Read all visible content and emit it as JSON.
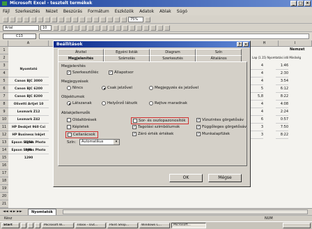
{
  "window": {
    "title": "Microsoft Excel - tesztelt termékek",
    "controls": [
      "_",
      "□",
      "×"
    ]
  },
  "menu": [
    "Fájl",
    "Szerkesztés",
    "Nézet",
    "Beszúrás",
    "Formátum",
    "Eszközök",
    "Adatok",
    "Ablak",
    "Súgó"
  ],
  "toolbar": {
    "zoom": "75%",
    "font": "Arial",
    "font_size": "10"
  },
  "formula_bar": {
    "cell_ref": "C13"
  },
  "sheet": {
    "col_headers": [
      "A",
      "B",
      "C",
      "D",
      "E",
      "F",
      "G",
      "H",
      "I"
    ],
    "row_numbers": [
      "1",
      "2",
      "3",
      "4",
      "5",
      "6",
      "7",
      "8",
      "9",
      "10",
      "11",
      "12",
      "13",
      "14",
      "15",
      "16",
      "17",
      "18",
      "19",
      "20",
      "21"
    ],
    "header_label": "Nyomtató",
    "right_header": "Nemzet",
    "right_subheader": "Lap (1.15) Nyomtatási idő Minőség",
    "rows": [
      {
        "name": "Canon BJC 3000",
        "c1": "4",
        "c2": "1:46"
      },
      {
        "name": "Canon BJC 6200",
        "c1": "4",
        "c2": "2:30"
      },
      {
        "name": "Canon BJC 8200",
        "c1": "4",
        "c2": "3:54"
      },
      {
        "name": "Olivetti Artjet 10",
        "c1": "5",
        "c2": "6:12"
      },
      {
        "name": "Lexmark Z12",
        "c1": "5,8",
        "c2": "8:22"
      },
      {
        "name": "Lexmark Z42",
        "c1": "4",
        "c2": "4:08"
      },
      {
        "name": "HP Deskjet 960 Cxi",
        "c1": "4",
        "c2": "2:24"
      },
      {
        "name": "HP Business Inkjet 2250",
        "c1": "6",
        "c2": "0:57"
      },
      {
        "name": "Epson Stylus Photo 890",
        "c1": "3",
        "c2": "7:50"
      },
      {
        "name": "Epson Stylus Photo 1290",
        "c1": "3",
        "c2": "8:22"
      }
    ]
  },
  "dialog": {
    "title": "Beállítások",
    "title_controls": [
      "?",
      "×"
    ],
    "tabs_row1": [
      "Átvitel",
      "Egyéni listák",
      "Diagram",
      "Szín"
    ],
    "tabs_row2": [
      "Megjelenítés",
      "Számolás",
      "Szerkesztés",
      "Általános"
    ],
    "group_show": "Megjelenítés",
    "show_items": [
      {
        "label": "Szerkesztőléc",
        "checked": true
      },
      {
        "label": "Állapotsor",
        "checked": true
      }
    ],
    "group_comments": "Megjegyzések",
    "comment_options": [
      {
        "label": "Nincs",
        "selected": false
      },
      {
        "label": "Csak jelzővel",
        "selected": true
      },
      {
        "label": "Megjegyzés és jelzővel",
        "selected": false
      }
    ],
    "group_objects": "Objektumok",
    "object_options": [
      {
        "label": "Látszanak",
        "selected": true
      },
      {
        "label": "Helyőrző látszik",
        "selected": false
      },
      {
        "label": "Rejtve maradnak",
        "selected": false
      }
    ],
    "group_window": "Ablakjellemzők",
    "window_col1": [
      {
        "label": "Oldaltörések",
        "checked": false
      },
      {
        "label": "Képletek",
        "checked": false
      },
      {
        "label": "Cellarácsok",
        "checked": false
      }
    ],
    "window_col2": [
      {
        "label": "Sor- és oszlopazonosítók",
        "checked": false
      },
      {
        "label": "Tagolási szimbólumok",
        "checked": true
      },
      {
        "label": "Zéró érték értékek",
        "checked": true
      }
    ],
    "window_col3": [
      {
        "label": "Vízszintes görgetősáv",
        "checked": true
      },
      {
        "label": "Függőleges görgetősáv",
        "checked": true
      },
      {
        "label": "Munkalapfülek",
        "checked": true
      }
    ],
    "color_label": "Szín:",
    "color_value": "Automatikus",
    "ok_label": "OK",
    "cancel_label": "Mégse"
  },
  "sheet_tab": "Nyomtatók",
  "status": {
    "left": "Kész",
    "right": "NUM"
  },
  "taskbar": [
    {
      "label": "Start",
      "active": false
    },
    {
      "label": "Microsoft W...",
      "active": false
    },
    {
      "label": "Inbox - Out...",
      "active": false
    },
    {
      "label": "Paint Shop...",
      "active": false
    },
    {
      "label": "Windows C...",
      "active": false
    },
    {
      "label": "Microsoft...",
      "active": true
    }
  ]
}
